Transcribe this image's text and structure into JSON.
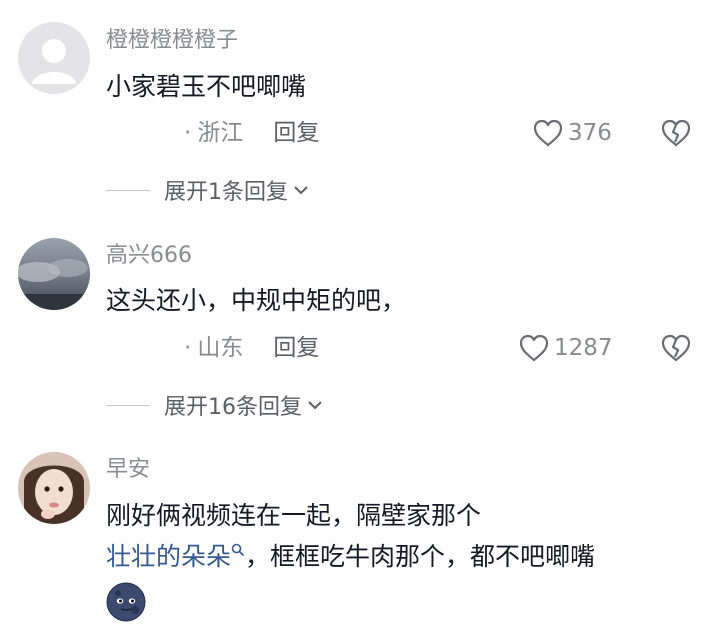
{
  "comments": [
    {
      "username": "橙橙橙橙橙子",
      "text": "小家碧玉不吧唧嘴",
      "location": "浙江",
      "reply_label": "回复",
      "likes": "376",
      "expand_label": "展开1条回复",
      "avatar": "default-avatar-icon"
    },
    {
      "username": "高兴666",
      "text": "这头还小，中规中矩的吧，",
      "location": "山东",
      "reply_label": "回复",
      "likes": "1287",
      "expand_label": "展开16条回复",
      "avatar": "cloudy-sky-photo"
    },
    {
      "username": "早安",
      "text_line1": "刚好俩视频连在一起，隔壁家那个",
      "mention": "壮壮的朵朵",
      "text_line2_rest": "，框框吃牛肉那个，都不吧唧嘴",
      "emoji": "moon-face-emoji",
      "avatar": "girl-photo"
    }
  ],
  "meta_separator": "·"
}
